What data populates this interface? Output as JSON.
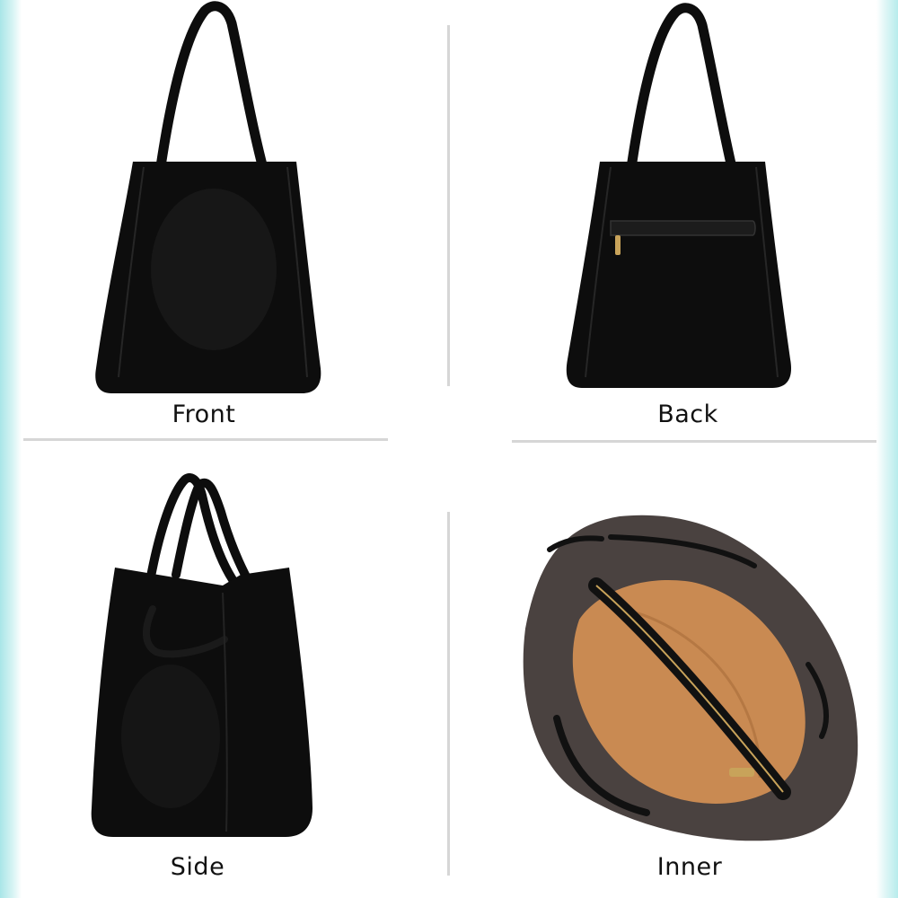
{
  "panels": {
    "front": {
      "label": "Front"
    },
    "back": {
      "label": "Back"
    },
    "side": {
      "label": "Side"
    },
    "inner": {
      "label": "Inner"
    }
  },
  "colors": {
    "leather": "#0d0d0d",
    "lining_suede": "#4a4240",
    "pouch_tan": "#c98a52",
    "zipper_gold": "#c8a35a"
  }
}
